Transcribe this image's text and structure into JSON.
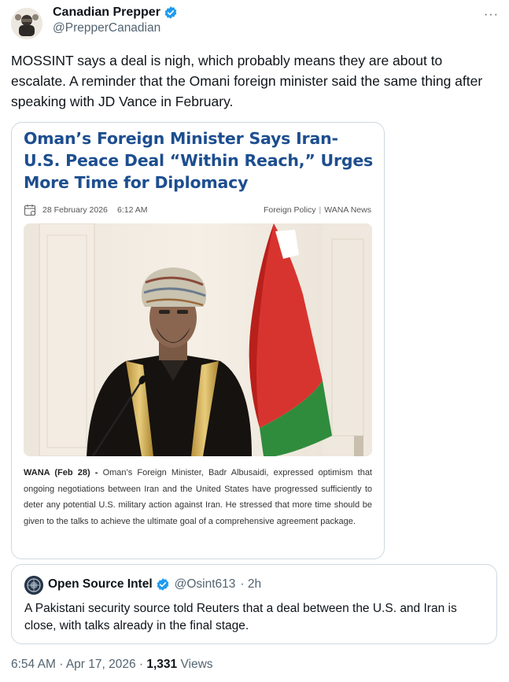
{
  "author": {
    "display_name": "Canadian Prepper",
    "handle": "@PrepperCanadian"
  },
  "more_label": "···",
  "tweet_text": "MOSSINT says a deal is nigh, which probably means they are about to escalate. A reminder that the Omani foreign minister said the same thing after speaking with JD Vance in February.",
  "article": {
    "title": "Oman’s Foreign Minister Says Iran-U.S. Peace Deal “Within Reach,” Urges More Time for Diplomacy",
    "date": "28 February 2026",
    "time": "6:12 AM",
    "category": "Foreign Policy",
    "source": "WANA News",
    "body_lead": "WANA (Feb 28) -",
    "body": "Oman’s Foreign Minister, Badr Albusaidi, expressed optimism that ongoing negotiations between Iran and the United States have progressed sufficiently to deter any potential U.S. military action against Iran. He stressed that more time should be given to the talks to achieve the ultimate goal of a comprehensive agreement package."
  },
  "quote": {
    "display_name": "Open Source Intel",
    "handle": "@Osint613",
    "time_ago": "· 2h",
    "text": "A Pakistani security source told Reuters that a deal between the U.S. and Iran is close, with talks already in the final stage."
  },
  "footer": {
    "time": "6:54 AM",
    "date": "Apr 17, 2026",
    "views_count": "1,331",
    "views_label": "Views",
    "sep": "·"
  },
  "colors": {
    "verified_blue": "#1d9bf0",
    "article_title": "#1d4e8f",
    "secondary_text": "#536471"
  },
  "icons": {
    "verified": "verified-badge-icon",
    "more": "more-icon",
    "calendar": "calendar-icon"
  }
}
